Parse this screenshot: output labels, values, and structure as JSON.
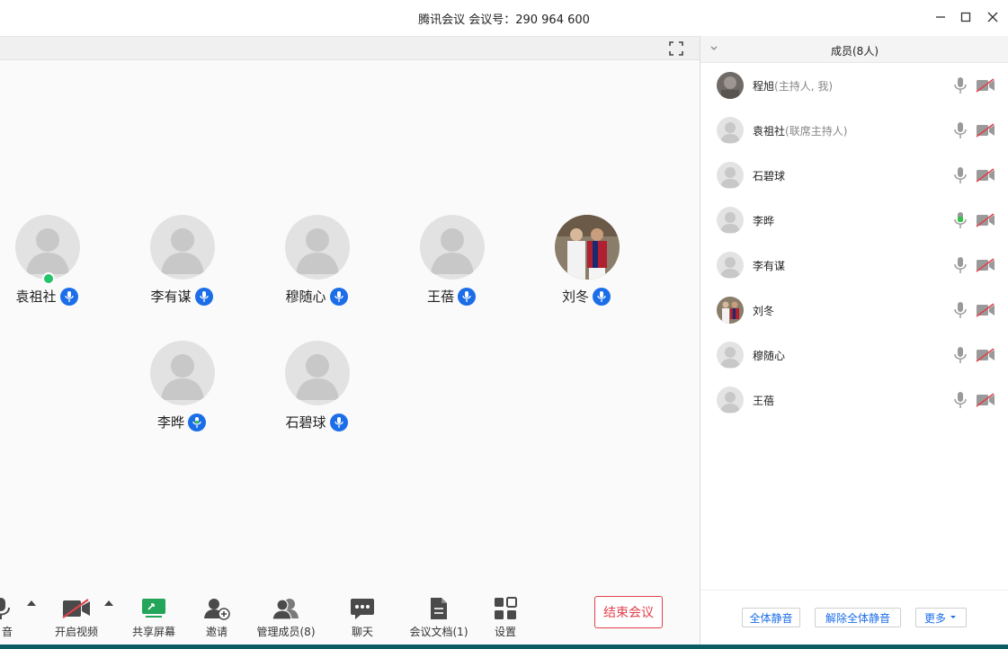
{
  "window": {
    "title": "腾讯会议 会议号：290 964 600",
    "minimize_icon": "minimize-icon",
    "maximize_icon": "maximize-icon",
    "close_icon": "close-icon"
  },
  "video_grid": {
    "participants": [
      {
        "name": "袁祖社",
        "avatar": "default",
        "host_badge": true
      },
      {
        "name": "李有谋",
        "avatar": "default",
        "host_badge": false
      },
      {
        "name": "穆随心",
        "avatar": "default",
        "host_badge": false
      },
      {
        "name": "王蓓",
        "avatar": "default",
        "host_badge": false
      },
      {
        "name": "刘冬",
        "avatar": "photo",
        "host_badge": false
      },
      {
        "name": "李晔",
        "avatar": "default",
        "host_badge": false
      },
      {
        "name": "石碧球",
        "avatar": "default",
        "host_badge": false
      }
    ]
  },
  "toolbar": {
    "mute_label": "音",
    "video_label": "开启视频",
    "share_label": "共享屏幕",
    "invite_label": "邀请",
    "manage_label": "管理成员(8)",
    "chat_label": "聊天",
    "docs_label": "会议文档(1)",
    "settings_label": "设置",
    "end_label": "结束会议"
  },
  "members_panel": {
    "title": "成员(8人)",
    "members": [
      {
        "name": "程旭",
        "role": "(主持人, 我)",
        "avatar": "photo-blur"
      },
      {
        "name": "袁祖社",
        "role": "(联席主持人)",
        "avatar": "default"
      },
      {
        "name": "石碧球",
        "role": "",
        "avatar": "default"
      },
      {
        "name": "李晔",
        "role": "",
        "avatar": "default",
        "speaking": true
      },
      {
        "name": "李有谋",
        "role": "",
        "avatar": "default"
      },
      {
        "name": "刘冬",
        "role": "",
        "avatar": "photo"
      },
      {
        "name": "穆随心",
        "role": "",
        "avatar": "default"
      },
      {
        "name": "王蓓",
        "role": "",
        "avatar": "default"
      }
    ],
    "mute_all_label": "全体静音",
    "unmute_all_label": "解除全体静音",
    "more_label": "更多"
  },
  "colors": {
    "accent": "#1c6ee8",
    "danger": "#e0414b",
    "speaking": "#35c24a",
    "host_badge": "#24c46a"
  }
}
